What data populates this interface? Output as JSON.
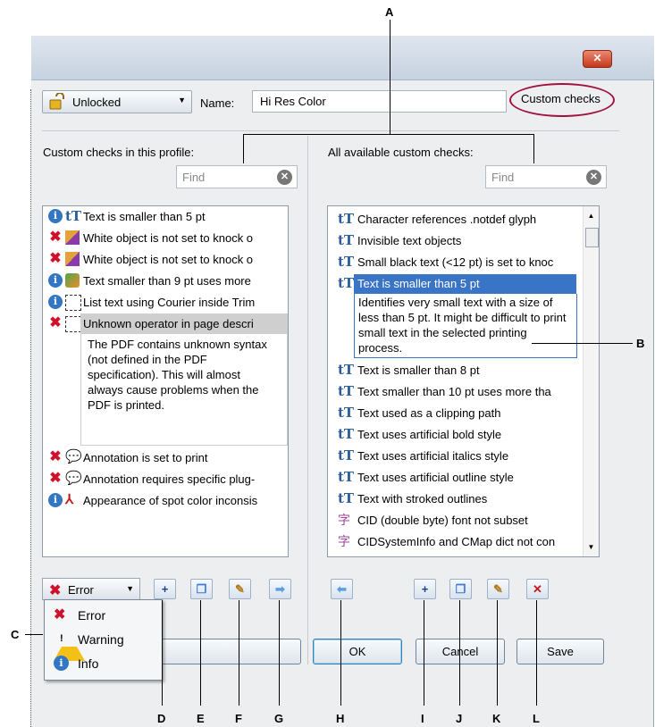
{
  "window": {
    "close_label": "✕"
  },
  "top": {
    "lock_combo_value": "Unlocked",
    "name_label": "Name:",
    "name_value": "Hi Res Color",
    "custom_checks_label": "Custom checks"
  },
  "left_panel": {
    "label": "Custom checks in this profile:",
    "find_placeholder": "Find",
    "rows": [
      {
        "severity": "info-icon",
        "type": "text-icon",
        "text": "Text is smaller than 5 pt"
      },
      {
        "severity": "error-icon",
        "type": "knockout-icon",
        "text": "White object is not set to knock o"
      },
      {
        "severity": "error-icon",
        "type": "knockout-icon",
        "text": "White object is not set to knock o"
      },
      {
        "severity": "info-icon",
        "type": "image-icon",
        "text": "Text smaller than 9 pt uses more"
      },
      {
        "severity": "info-icon",
        "type": "operator-icon",
        "text": "List text using Courier inside Trim"
      },
      {
        "severity": "error-icon",
        "type": "operator-icon",
        "text": "Unknown operator in page descri"
      }
    ],
    "selected_description": "The PDF contains unknown syntax (not defined in the PDF specification). This will almost always cause problems when the PDF is printed.",
    "rows_after": [
      {
        "severity": "error-icon",
        "type": "annotation-icon",
        "text": "Annotation is set to print"
      },
      {
        "severity": "error-icon",
        "type": "annotation-icon",
        "text": "Annotation requires specific plug-"
      },
      {
        "severity": "info-icon",
        "type": "pdf-icon",
        "text": "Appearance of spot color inconsis"
      }
    ]
  },
  "right_panel": {
    "label": "All available custom checks:",
    "find_placeholder": "Find",
    "rows_before": [
      {
        "type": "text-icon",
        "text": "Character references .notdef glyph"
      },
      {
        "type": "text-icon",
        "text": "Invisible text objects"
      },
      {
        "type": "text-icon",
        "text": "Small black text (<12 pt) is set to knoc"
      }
    ],
    "selected": {
      "type": "text-icon",
      "text": "Text is smaller than 5 pt",
      "description": "Identifies very small text with a size of less than 5 pt. It might be difficult to print small text in the selected printing process."
    },
    "rows_after": [
      {
        "type": "text-icon",
        "text": "Text is smaller than 8 pt"
      },
      {
        "type": "text-icon",
        "text": "Text smaller than 10 pt uses more tha"
      },
      {
        "type": "text-icon",
        "text": "Text used as a clipping path"
      },
      {
        "type": "text-icon",
        "text": "Text uses artificial bold style"
      },
      {
        "type": "text-icon",
        "text": "Text uses artificial italics style"
      },
      {
        "type": "text-icon",
        "text": "Text uses artificial outline style"
      },
      {
        "type": "text-icon",
        "text": "Text with stroked outlines"
      },
      {
        "type": "cid-icon",
        "text": "CID (double byte) font not subset"
      },
      {
        "type": "cid-icon",
        "text": "CIDSystemInfo and CMap dict not con"
      }
    ]
  },
  "toolbar": {
    "severity_value": "Error",
    "severity_options": [
      "Error",
      "Warning",
      "Info"
    ],
    "icons": {
      "new": "+",
      "duplicate": "❐",
      "edit": "✎",
      "move_right": "➡",
      "move_left": "⬅",
      "delete": "✕"
    }
  },
  "buttons": {
    "ok": "OK",
    "cancel": "Cancel",
    "save": "Save"
  },
  "callouts": {
    "A": "A",
    "B": "B",
    "C": "C",
    "D": "D",
    "E": "E",
    "F": "F",
    "G": "G",
    "H": "H",
    "I": "I",
    "J": "J",
    "K": "K",
    "L": "L"
  },
  "colors": {
    "error": "#d0112b",
    "info": "#3377c4",
    "selection": "#3a74c7",
    "callout_oval": "#a1133e"
  }
}
